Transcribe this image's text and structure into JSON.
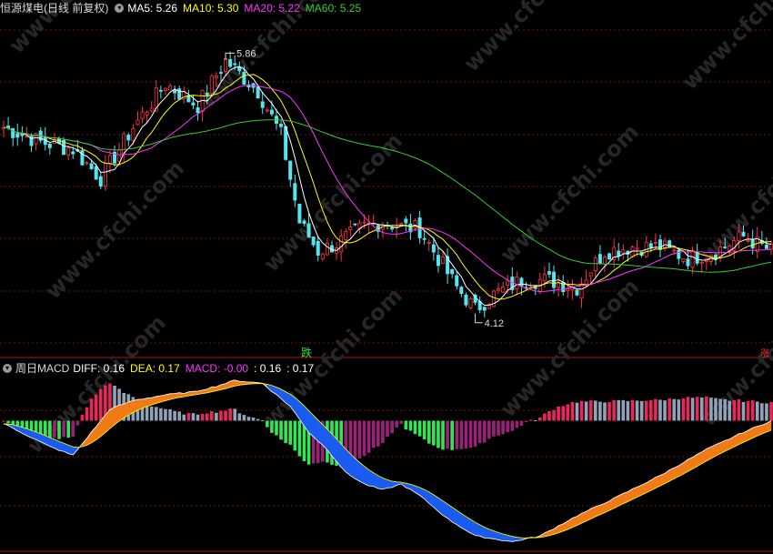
{
  "header": {
    "stock_name": "恒源煤电(日线 前复权)",
    "ma": [
      {
        "label": "MA5: 5.26",
        "color": "#ffffff"
      },
      {
        "label": "MA10: 5.30",
        "color": "#ffff00"
      },
      {
        "label": "MA20: 5.22",
        "color": "#ff33ff"
      },
      {
        "label": "MA60: 5.25",
        "color": "#33cc33"
      }
    ]
  },
  "macd_header": {
    "title": "周日MACD",
    "items": [
      {
        "label": "DIFF: 0.16",
        "color": "#ffffff"
      },
      {
        "label": "DEA: 0.17",
        "color": "#ffff00"
      },
      {
        "label": "MACD: -0.00",
        "color": "#ff33ff"
      },
      {
        "label": ": 0.16",
        "color": "#ffffff"
      },
      {
        "label": ": 0.17",
        "color": "#ffffff"
      }
    ]
  },
  "watermark": "www.cfchi.com",
  "chart_data": [
    {
      "type": "candlestick",
      "title": "恒源煤电(日线 前复权)",
      "ylim": [
        3.9,
        6.15
      ],
      "annotations": [
        {
          "text": "5.86",
          "kind": "high"
        },
        {
          "text": "4.12",
          "kind": "low"
        },
        {
          "text": "跌",
          "color": "#33dd33"
        },
        {
          "text": "涨",
          "color": "#ff3333"
        }
      ],
      "series": [
        {
          "name": "MA5",
          "color": "#ffffff"
        },
        {
          "name": "MA10",
          "color": "#ffff00"
        },
        {
          "name": "MA20",
          "color": "#ff33ff"
        },
        {
          "name": "MA60",
          "color": "#33cc33"
        }
      ],
      "keypoints": [
        [
          0,
          5.4
        ],
        [
          8,
          5.3
        ],
        [
          15,
          5.25
        ],
        [
          21,
          5.05
        ],
        [
          28,
          5.4
        ],
        [
          35,
          5.7
        ],
        [
          42,
          5.55
        ],
        [
          48,
          5.86
        ],
        [
          55,
          5.65
        ],
        [
          60,
          5.35
        ],
        [
          64,
          4.75
        ],
        [
          68,
          4.55
        ],
        [
          72,
          4.6
        ],
        [
          78,
          4.72
        ],
        [
          82,
          4.75
        ],
        [
          86,
          4.72
        ],
        [
          90,
          4.7
        ],
        [
          94,
          4.5
        ],
        [
          98,
          4.3
        ],
        [
          102,
          4.15
        ],
        [
          106,
          4.25
        ],
        [
          112,
          4.35
        ],
        [
          118,
          4.35
        ],
        [
          124,
          4.3
        ],
        [
          130,
          4.55
        ],
        [
          136,
          4.58
        ],
        [
          142,
          4.58
        ],
        [
          148,
          4.5
        ],
        [
          154,
          4.55
        ],
        [
          160,
          4.65
        ],
        [
          166,
          4.55
        ]
      ]
    },
    {
      "type": "macd",
      "title": "周日MACD",
      "values": {
        "DIFF": 0.16,
        "DEA": 0.17,
        "MACD": -0.0
      },
      "ylim": [
        -0.45,
        0.15
      ],
      "keypoints": [
        [
          0,
          -0.01
        ],
        [
          5,
          -0.05
        ],
        [
          10,
          -0.09
        ],
        [
          15,
          -0.12
        ],
        [
          18,
          -0.06
        ],
        [
          23,
          0.04
        ],
        [
          28,
          0.07
        ],
        [
          35,
          0.09
        ],
        [
          41,
          0.1
        ],
        [
          46,
          0.12
        ],
        [
          50,
          0.14
        ],
        [
          56,
          0.13
        ],
        [
          62,
          0.05
        ],
        [
          66,
          -0.04
        ],
        [
          70,
          -0.1
        ],
        [
          74,
          -0.18
        ],
        [
          78,
          -0.22
        ],
        [
          82,
          -0.24
        ],
        [
          86,
          -0.22
        ],
        [
          90,
          -0.26
        ],
        [
          96,
          -0.34
        ],
        [
          102,
          -0.4
        ],
        [
          110,
          -0.42
        ],
        [
          116,
          -0.4
        ],
        [
          124,
          -0.33
        ],
        [
          132,
          -0.27
        ],
        [
          142,
          -0.19
        ],
        [
          152,
          -0.1
        ],
        [
          160,
          -0.04
        ],
        [
          166,
          0.0
        ]
      ]
    }
  ]
}
